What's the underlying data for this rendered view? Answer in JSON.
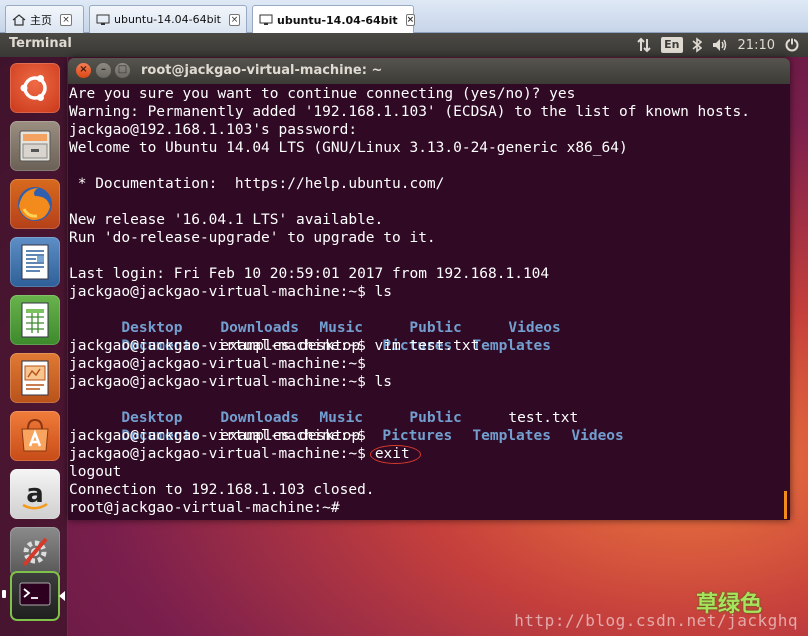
{
  "vm_tabs": [
    {
      "label": "主页",
      "icon": "home-icon"
    },
    {
      "label": "ubuntu-14.04-64bit",
      "icon": "vm-icon"
    },
    {
      "label": "ubuntu-14.04-64bit",
      "icon": "vm-icon",
      "active": true
    }
  ],
  "panel": {
    "app_title": "Terminal",
    "keyboard_layout": "En",
    "clock": "21:10"
  },
  "launcher": [
    {
      "name": "dash-home-icon"
    },
    {
      "name": "files-icon"
    },
    {
      "name": "firefox-icon"
    },
    {
      "name": "libreoffice-writer-icon"
    },
    {
      "name": "libreoffice-calc-icon"
    },
    {
      "name": "libreoffice-impress-icon"
    },
    {
      "name": "software-center-icon"
    },
    {
      "name": "amazon-icon"
    },
    {
      "name": "system-settings-icon"
    },
    {
      "name": "terminal-icon"
    }
  ],
  "terminal": {
    "window_title": "root@jackgao-virtual-machine: ~",
    "lines": [
      "Are you sure you want to continue connecting (yes/no)? yes",
      "Warning: Permanently added '192.168.1.103' (ECDSA) to the list of known hosts.",
      "jackgao@192.168.1.103's password:",
      "Welcome to Ubuntu 14.04 LTS (GNU/Linux 3.13.0-24-generic x86_64)",
      "",
      " * Documentation:  https://help.ubuntu.com/",
      "",
      "New release '16.04.1 LTS' available.",
      "Run 'do-release-upgrade' to upgrade to it.",
      "",
      "Last login: Fri Feb 10 20:59:01 2017 from 192.168.1.104",
      "jackgao@jackgao-virtual-machine:~$ ls"
    ],
    "ls1": [
      [
        "Desktop",
        "Downloads",
        "Music",
        "Public",
        "Videos"
      ],
      [
        "Documents",
        "examples.desktop",
        "Pictures",
        "Templates",
        ""
      ]
    ],
    "mid_lines": [
      "jackgao@jackgao-virtual-machine:~$ vim test.txt",
      "jackgao@jackgao-virtual-machine:~$",
      "jackgao@jackgao-virtual-machine:~$ ls"
    ],
    "ls2": [
      [
        "Desktop",
        "Downloads",
        "Music",
        "Public",
        "test.txt"
      ],
      [
        "Documents",
        "examples.desktop",
        "Pictures",
        "Templates",
        "Videos"
      ]
    ],
    "prompt_blank": "jackgao@jackgao-virtual-machine:~$",
    "prompt_exit": "jackgao@jackgao-virtual-machine:~$",
    "exit_command": "exit",
    "tail_lines": [
      "logout",
      "Connection to 192.168.1.103 closed.",
      "root@jackgao-virtual-machine:~#"
    ]
  },
  "watermark": {
    "url": "http://blog.csdn.net/jackghq",
    "cn_text": "草绿色"
  }
}
